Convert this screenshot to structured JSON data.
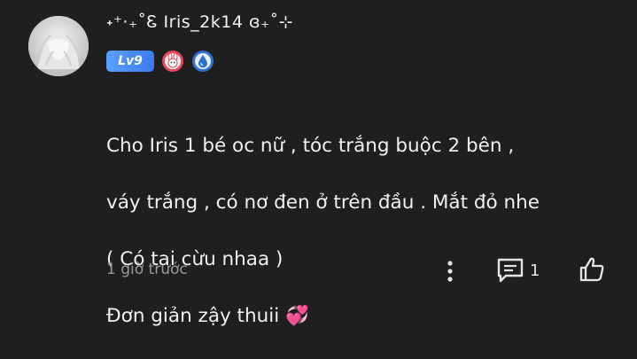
{
  "comment": {
    "username": "˖⁺‧₊˚Ꮛ Iris_2k14 ɞ₊˚⊹",
    "level_badge": "Lv9",
    "badges": [
      "bunny-badge-icon",
      "water-drop-badge-icon"
    ],
    "text_lines": [
      "Cho Iris 1 bé oc nữ , tóc trắng buộc 2 bên ,",
      "váy trắng , có nơ đen ở trên đầu . Mắt đỏ nhe",
      "( Có tai cừu nhaa )",
      "Đơn giản zậy thuii 💞"
    ],
    "timestamp": "1 giờ trước",
    "reply_count": "1"
  },
  "colors": {
    "background": "#1f1f1f",
    "text": "#f1f1f1",
    "muted": "#9a9a9a",
    "level_badge": "#4a8cf7"
  }
}
